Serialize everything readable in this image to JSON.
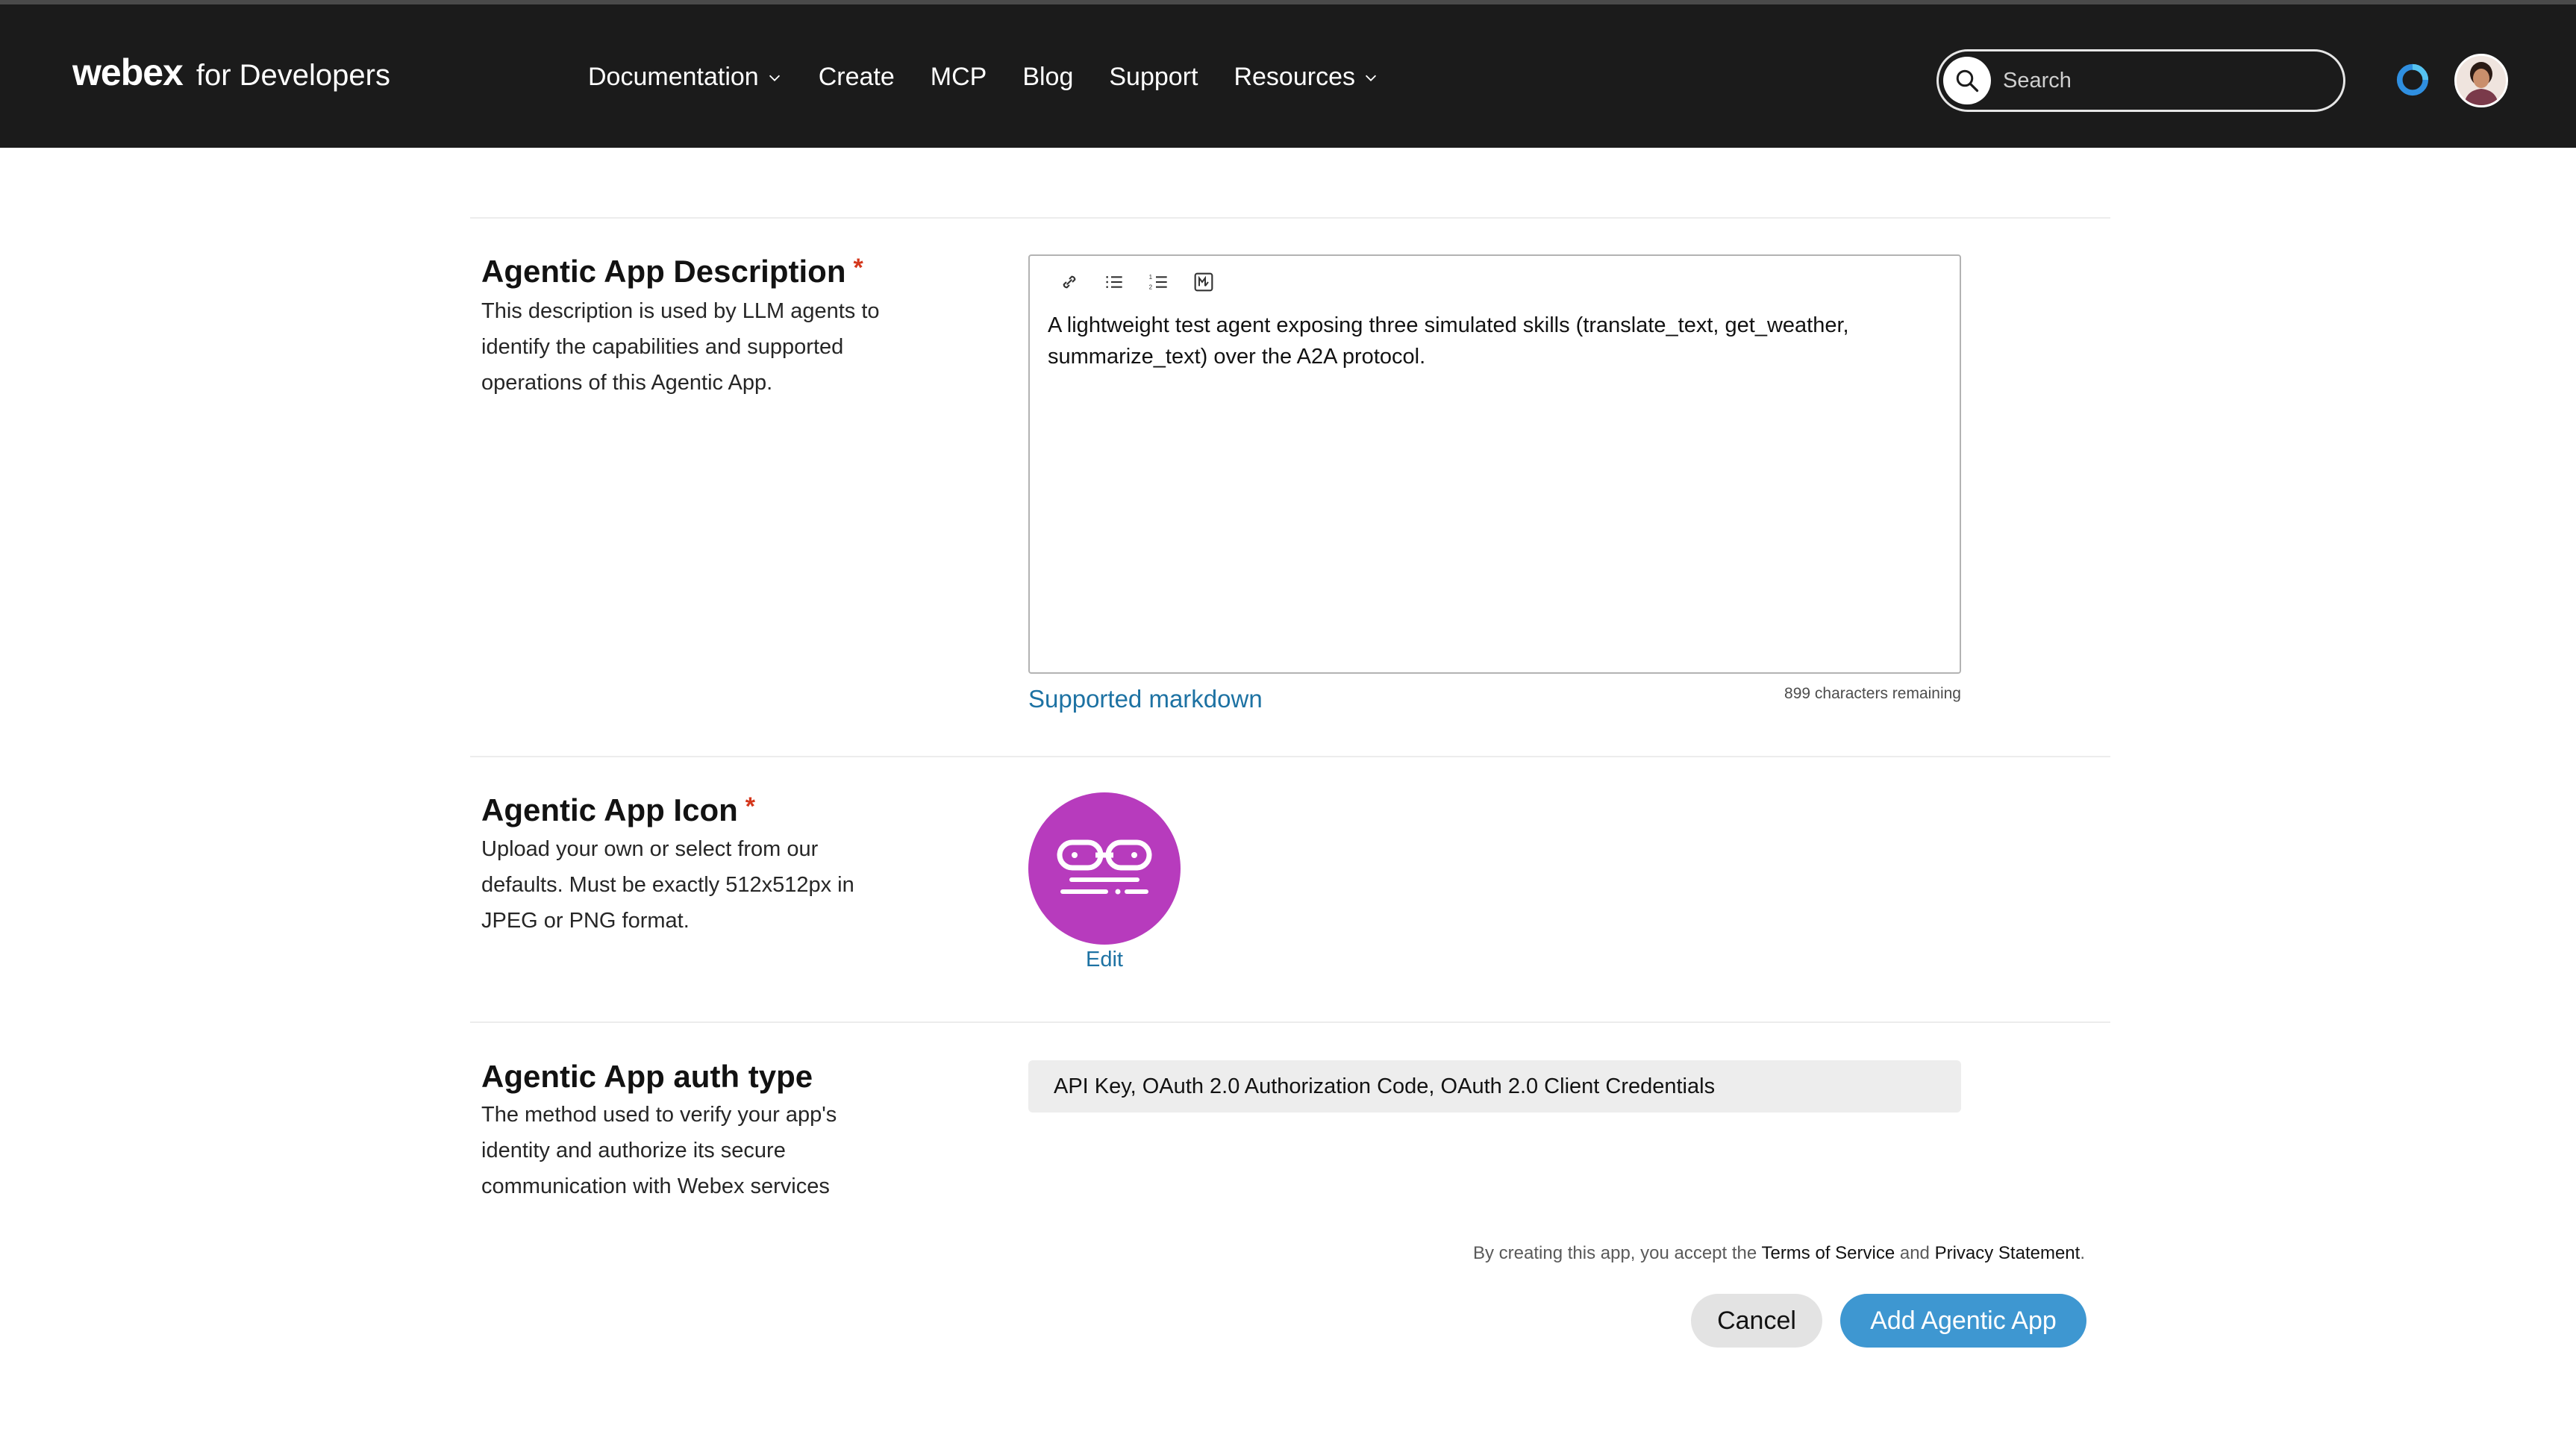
{
  "header": {
    "brand": "webex",
    "brand_suffix": "for Developers",
    "nav": [
      {
        "label": "Documentation",
        "has_dropdown": true
      },
      {
        "label": "Create",
        "has_dropdown": false
      },
      {
        "label": "MCP",
        "has_dropdown": false
      },
      {
        "label": "Blog",
        "has_dropdown": false
      },
      {
        "label": "Support",
        "has_dropdown": false
      },
      {
        "label": "Resources",
        "has_dropdown": true
      }
    ],
    "search": {
      "placeholder": "Search",
      "value": ""
    },
    "icons": [
      "search-icon",
      "webex-app-icon",
      "user-avatar"
    ]
  },
  "description_section": {
    "title": "Agentic App Description",
    "required_mark": "*",
    "help": "This description is used by LLM agents to identify the capabilities and supported operations of this Agentic App.",
    "toolbar": [
      "link-icon",
      "bulleted-list-icon",
      "numbered-list-icon",
      "markdown-icon"
    ],
    "value": "A lightweight test agent exposing three simulated skills (translate_text, get_weather, summarize_text) over the A2A protocol.",
    "markdown_link": "Supported markdown",
    "chars_remaining": "899 characters remaining"
  },
  "icon_section": {
    "title": "Agentic App Icon",
    "required_mark": "*",
    "help": "Upload your own or select from our defaults. Must be exactly 512x512px in JPEG or PNG format.",
    "icon_color": "#b73bbd",
    "edit_label": "Edit"
  },
  "auth_section": {
    "title": "Agentic App auth type",
    "help": "The method used to verify your app's identity and authorize its secure communication with Webex services",
    "value": "API Key, OAuth 2.0 Authorization Code, OAuth 2.0 Client Credentials"
  },
  "footer": {
    "terms_prefix": "By creating this app, you accept the",
    "terms_link": "Terms of Service",
    "terms_and": "and",
    "privacy_link": "Privacy Statement",
    "terms_end": ".",
    "cancel_label": "Cancel",
    "submit_label": "Add Agentic App"
  },
  "colors": {
    "nav_bg": "#1b1b1b",
    "link": "#1d72a3",
    "primary_button": "#3e97d1",
    "required": "#d4371c",
    "icon_bg": "#b73bbd"
  }
}
